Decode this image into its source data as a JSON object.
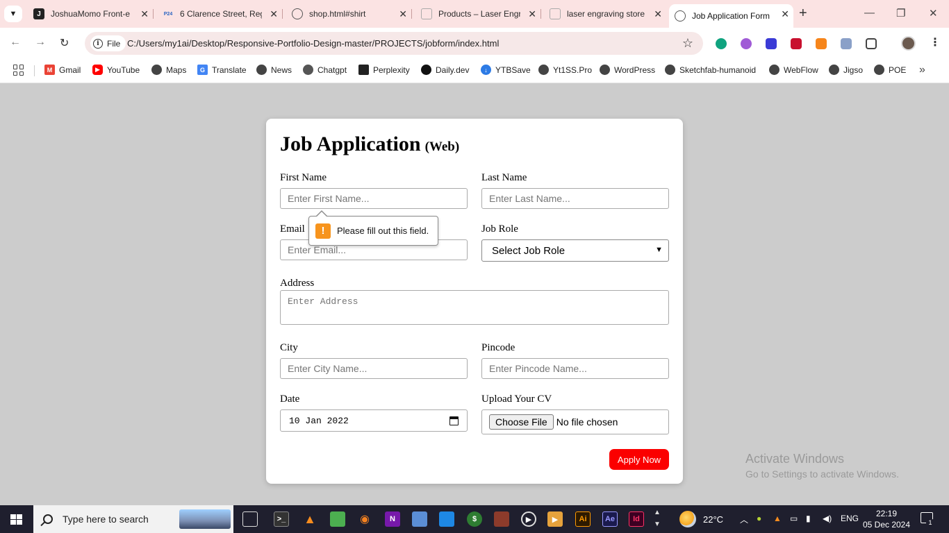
{
  "browser": {
    "tabs": [
      {
        "title": "JoshuaMomo Front-e",
        "favicon_letter": "J",
        "favicon_color": "#222222",
        "active": false
      },
      {
        "title": "6 Clarence Street, Reg",
        "favicon_letter": "P24",
        "favicon_color": "#2b65c2",
        "active": false
      },
      {
        "title": "shop.html#shirt",
        "favicon_letter": "",
        "favicon_color": "#555555",
        "active": false
      },
      {
        "title": "Products – Laser Engr",
        "favicon_letter": "",
        "favicon_color": "#888888",
        "active": false
      },
      {
        "title": "laser engraving store",
        "favicon_letter": "",
        "favicon_color": "#888888",
        "active": false
      },
      {
        "title": "Job Application Form",
        "favicon_letter": "",
        "favicon_color": "#555555",
        "active": true
      }
    ],
    "address": {
      "scheme_label": "File",
      "url": "C:/Users/my1ai/Desktop/Responsive-Portfolio-Design-master/PROJECTS/jobform/index.html"
    },
    "bookmarks": [
      {
        "label": "Gmail",
        "color": "#ea4335"
      },
      {
        "label": "YouTube",
        "color": "#ff0000"
      },
      {
        "label": "Maps",
        "color": "#444444"
      },
      {
        "label": "Translate",
        "color": "#4285f4"
      },
      {
        "label": "News",
        "color": "#444444"
      },
      {
        "label": "Chatgpt",
        "color": "#444444"
      },
      {
        "label": "Perplexity",
        "color": "#222222"
      },
      {
        "label": "Daily.dev",
        "color": "#111111"
      },
      {
        "label": "YTBSave",
        "color": "#2d7be5"
      },
      {
        "label": "Yt1SS.Pro",
        "color": "#444444"
      },
      {
        "label": "WordPress",
        "color": "#444444"
      },
      {
        "label": "Sketchfab-humanoid",
        "color": "#444444"
      },
      {
        "label": "WebFlow",
        "color": "#444444"
      },
      {
        "label": "Jigso",
        "color": "#444444"
      },
      {
        "label": "POE",
        "color": "#444444"
      }
    ]
  },
  "form": {
    "title": "Job Application",
    "title_suffix": "(Web)",
    "first_name": {
      "label": "First Name",
      "placeholder": "Enter First Name..."
    },
    "last_name": {
      "label": "Last Name",
      "placeholder": "Enter Last Name..."
    },
    "email": {
      "label": "Email",
      "placeholder": "Enter Email..."
    },
    "job_role": {
      "label": "Job Role",
      "selected": "Select Job Role"
    },
    "address": {
      "label": "Address",
      "placeholder": "Enter Address"
    },
    "city": {
      "label": "City",
      "placeholder": "Enter City Name..."
    },
    "pincode": {
      "label": "Pincode",
      "placeholder": "Enter Pincode Name..."
    },
    "date": {
      "label": "Date",
      "value": "10 Jan 2022"
    },
    "cv": {
      "label": "Upload Your CV",
      "button": "Choose File",
      "status": "No file chosen"
    },
    "submit_label": "Apply Now",
    "validation_message": "Please fill out this field."
  },
  "watermark": {
    "line1": "Activate Windows",
    "line2": "Go to Settings to activate Windows."
  },
  "taskbar": {
    "search_placeholder": "Type here to search",
    "weather": "22°C",
    "language": "ENG",
    "time": "22:19",
    "date": "05 Dec 2024",
    "notification_count": "1"
  },
  "colors": {
    "accent_button": "#fb0000",
    "tab_strip": "#fbe3e3",
    "page_background": "#cccccc",
    "warning": "#f7941d"
  }
}
